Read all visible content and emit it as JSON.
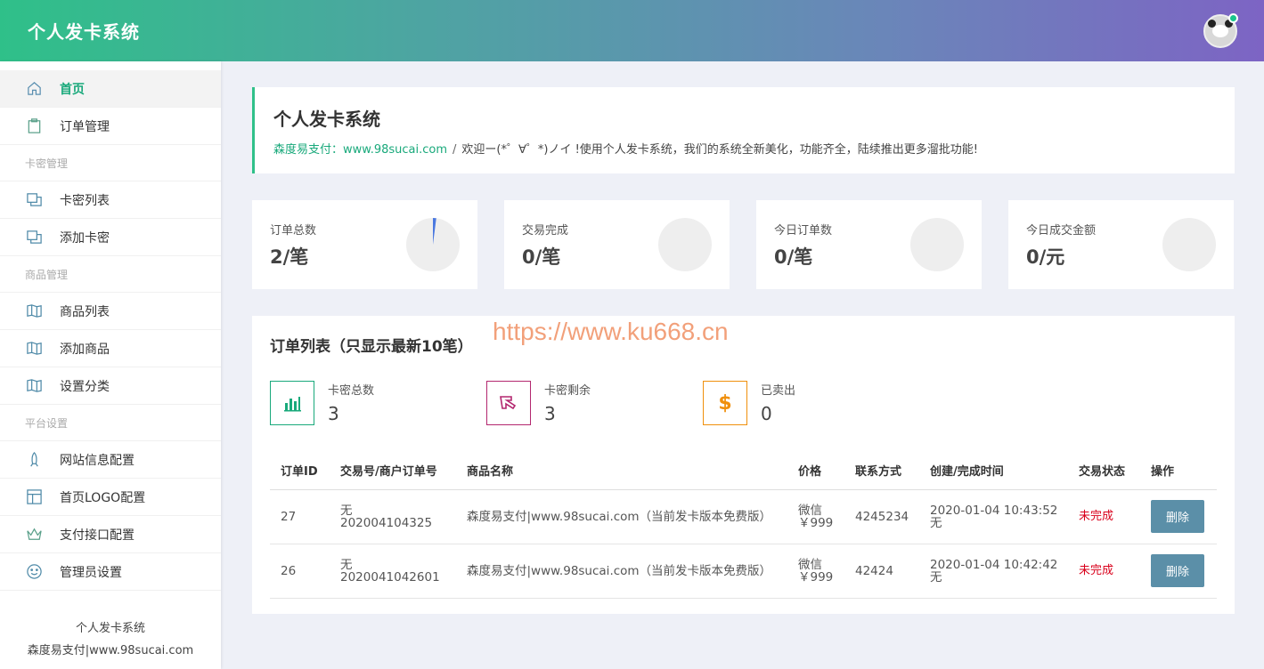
{
  "header": {
    "title": "个人发卡系统"
  },
  "sidebar": {
    "items": [
      {
        "type": "item",
        "label": "首页",
        "icon": "home-icon",
        "active": true
      },
      {
        "type": "item",
        "label": "订单管理",
        "icon": "clipboard-icon"
      },
      {
        "type": "group",
        "label": "卡密管理"
      },
      {
        "type": "item",
        "label": "卡密列表",
        "icon": "copy-icon"
      },
      {
        "type": "item",
        "label": "添加卡密",
        "icon": "copy-icon"
      },
      {
        "type": "group",
        "label": "商品管理"
      },
      {
        "type": "item",
        "label": "商品列表",
        "icon": "map-icon"
      },
      {
        "type": "item",
        "label": "添加商品",
        "icon": "map-icon"
      },
      {
        "type": "item",
        "label": "设置分类",
        "icon": "map-icon"
      },
      {
        "type": "group",
        "label": "平台设置"
      },
      {
        "type": "item",
        "label": "网站信息配置",
        "icon": "rocket-icon"
      },
      {
        "type": "item",
        "label": "首页LOGO配置",
        "icon": "layout-icon"
      },
      {
        "type": "item",
        "label": "支付接口配置",
        "icon": "crown-icon"
      },
      {
        "type": "item",
        "label": "管理员设置",
        "icon": "smile-icon"
      }
    ],
    "footer_line1": "个人发卡系统",
    "footer_line2": "森度易支付|www.98sucai.com"
  },
  "welcome": {
    "title": "个人发卡系统",
    "site_link": "森度易支付：www.98sucai.com",
    "separator": "/",
    "message": "欢迎ー(*゜∀゜*)ノイ !使用个人发卡系统，我们的系统全新美化，功能齐全，陆续推出更多溜批功能!"
  },
  "stats": [
    {
      "label": "订单总数",
      "value": "2/笔",
      "fraction": 0.02
    },
    {
      "label": "交易完成",
      "value": "0/笔",
      "fraction": 0
    },
    {
      "label": "今日订单数",
      "value": "0/笔",
      "fraction": 0
    },
    {
      "label": "今日成交金额",
      "value": "0/元",
      "fraction": 0
    }
  ],
  "orders": {
    "title": "订单列表（只显示最新10笔）",
    "watermark": "https://www.ku668.cn",
    "kpis": [
      {
        "label": "卡密总数",
        "value": "3",
        "icon": "bar-chart-icon",
        "color": "#19a97b"
      },
      {
        "label": "卡密剩余",
        "value": "3",
        "icon": "hand-icon",
        "color": "#b3276f"
      },
      {
        "label": "已卖出",
        "value": "0",
        "icon": "dollar-icon",
        "color": "#f0900c"
      }
    ],
    "columns": [
      "订单ID",
      "交易号/商户订单号",
      "商品名称",
      "价格",
      "联系方式",
      "创建/完成时间",
      "交易状态",
      "操作"
    ],
    "rows": [
      {
        "id": "27",
        "trade_no": "无",
        "merchant_no": "202004104325",
        "product": "森度易支付|www.98sucai.com（当前发卡版本免费版）",
        "pay": "微信",
        "price": "￥999",
        "contact": "4245234",
        "created": "2020-01-04 10:43:52",
        "finished": "无",
        "status": "未完成",
        "action": "删除"
      },
      {
        "id": "26",
        "trade_no": "无",
        "merchant_no": "2020041042601",
        "product": "森度易支付|www.98sucai.com（当前发卡版本免费版）",
        "pay": "微信",
        "price": "￥999",
        "contact": "42424",
        "created": "2020-01-04 10:42:42",
        "finished": "无",
        "status": "未完成",
        "action": "删除"
      }
    ]
  }
}
